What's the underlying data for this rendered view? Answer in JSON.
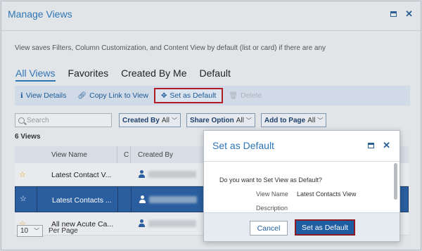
{
  "window": {
    "title": "Manage Views"
  },
  "description": "View saves Filters, Column Customization, and Content View by default (list or card) if there are any",
  "tabs": [
    {
      "label": "All Views"
    },
    {
      "label": "Favorites"
    },
    {
      "label": "Created By Me"
    },
    {
      "label": "Default"
    }
  ],
  "toolbar": {
    "view_details": "View Details",
    "copy_link": "Copy Link to View",
    "set_default": "Set as Default",
    "delete": "Delete"
  },
  "filters": {
    "search_placeholder": "Search",
    "created_by": {
      "label": "Created By",
      "value": "All"
    },
    "share_option": {
      "label": "Share Option",
      "value": "All"
    },
    "add_to_page": {
      "label": "Add to Page",
      "value": "All"
    }
  },
  "views_count": "6 Views",
  "table": {
    "columns": {
      "name": "View Name",
      "c": "C",
      "created_by": "Created By"
    },
    "rows": [
      {
        "name": "Latest Contact V..."
      },
      {
        "name": "Latest Contacts ..."
      },
      {
        "name": "All new Acute Ca..."
      }
    ]
  },
  "pager": {
    "size": "10",
    "label": "Per Page"
  },
  "dialog": {
    "title": "Set as Default",
    "question": "Do you want to Set View as Default?",
    "view_name_label": "View Name",
    "view_name_value": "Latest Contacts View",
    "description_label": "Description",
    "cancel": "Cancel",
    "confirm": "Set as Default"
  },
  "colors": {
    "accent": "#2e75b6",
    "selected_row": "#2a5e9e",
    "highlight_border": "#b01c25",
    "star": "#f0a30a"
  }
}
